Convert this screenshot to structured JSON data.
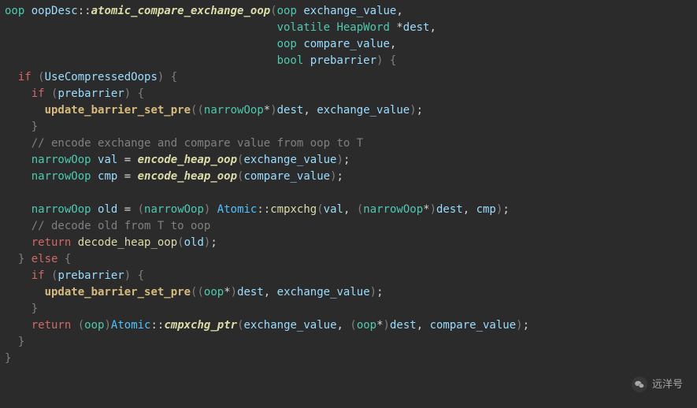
{
  "code": {
    "t_oop": "oop",
    "t_narrow": "narrowOop",
    "t_volatile": "volatile",
    "t_HeapWord": "HeapWord",
    "t_bool": "bool",
    "sig_class": "oopDesc",
    "sig_fn": "atomic_compare_exchange_oop",
    "p_exchange_value": "exchange_value",
    "p_dest": "dest",
    "p_compare_value": "compare_value",
    "p_prebarrier": "prebarrier",
    "kw_if": "if",
    "kw_else": "else",
    "kw_return": "return",
    "id_UseCompressedOops": "UseCompressedOops",
    "fn_update_barrier_set_pre": "update_barrier_set_pre",
    "comment1": "// encode exchange and compare value from oop to T",
    "id_val": "val",
    "id_cmp": "cmp",
    "id_old": "old",
    "fn_encode_heap_oop": "encode_heap_oop",
    "id_Atomic": "Atomic",
    "fn_cmpxchg": "cmpxchg",
    "comment2": "// decode old from T to oop",
    "fn_decode_heap_oop": "decode_heap_oop",
    "fn_cmpxchg_ptr": "cmpxchg_ptr",
    "star": "*",
    "scope": "::",
    "eq": " = ",
    "comma": ", ",
    "semi": ";",
    "lparen": "(",
    "rparen": ")",
    "lbrace": "{",
    "rbrace": "}"
  },
  "badge": {
    "text": "远洋号"
  }
}
